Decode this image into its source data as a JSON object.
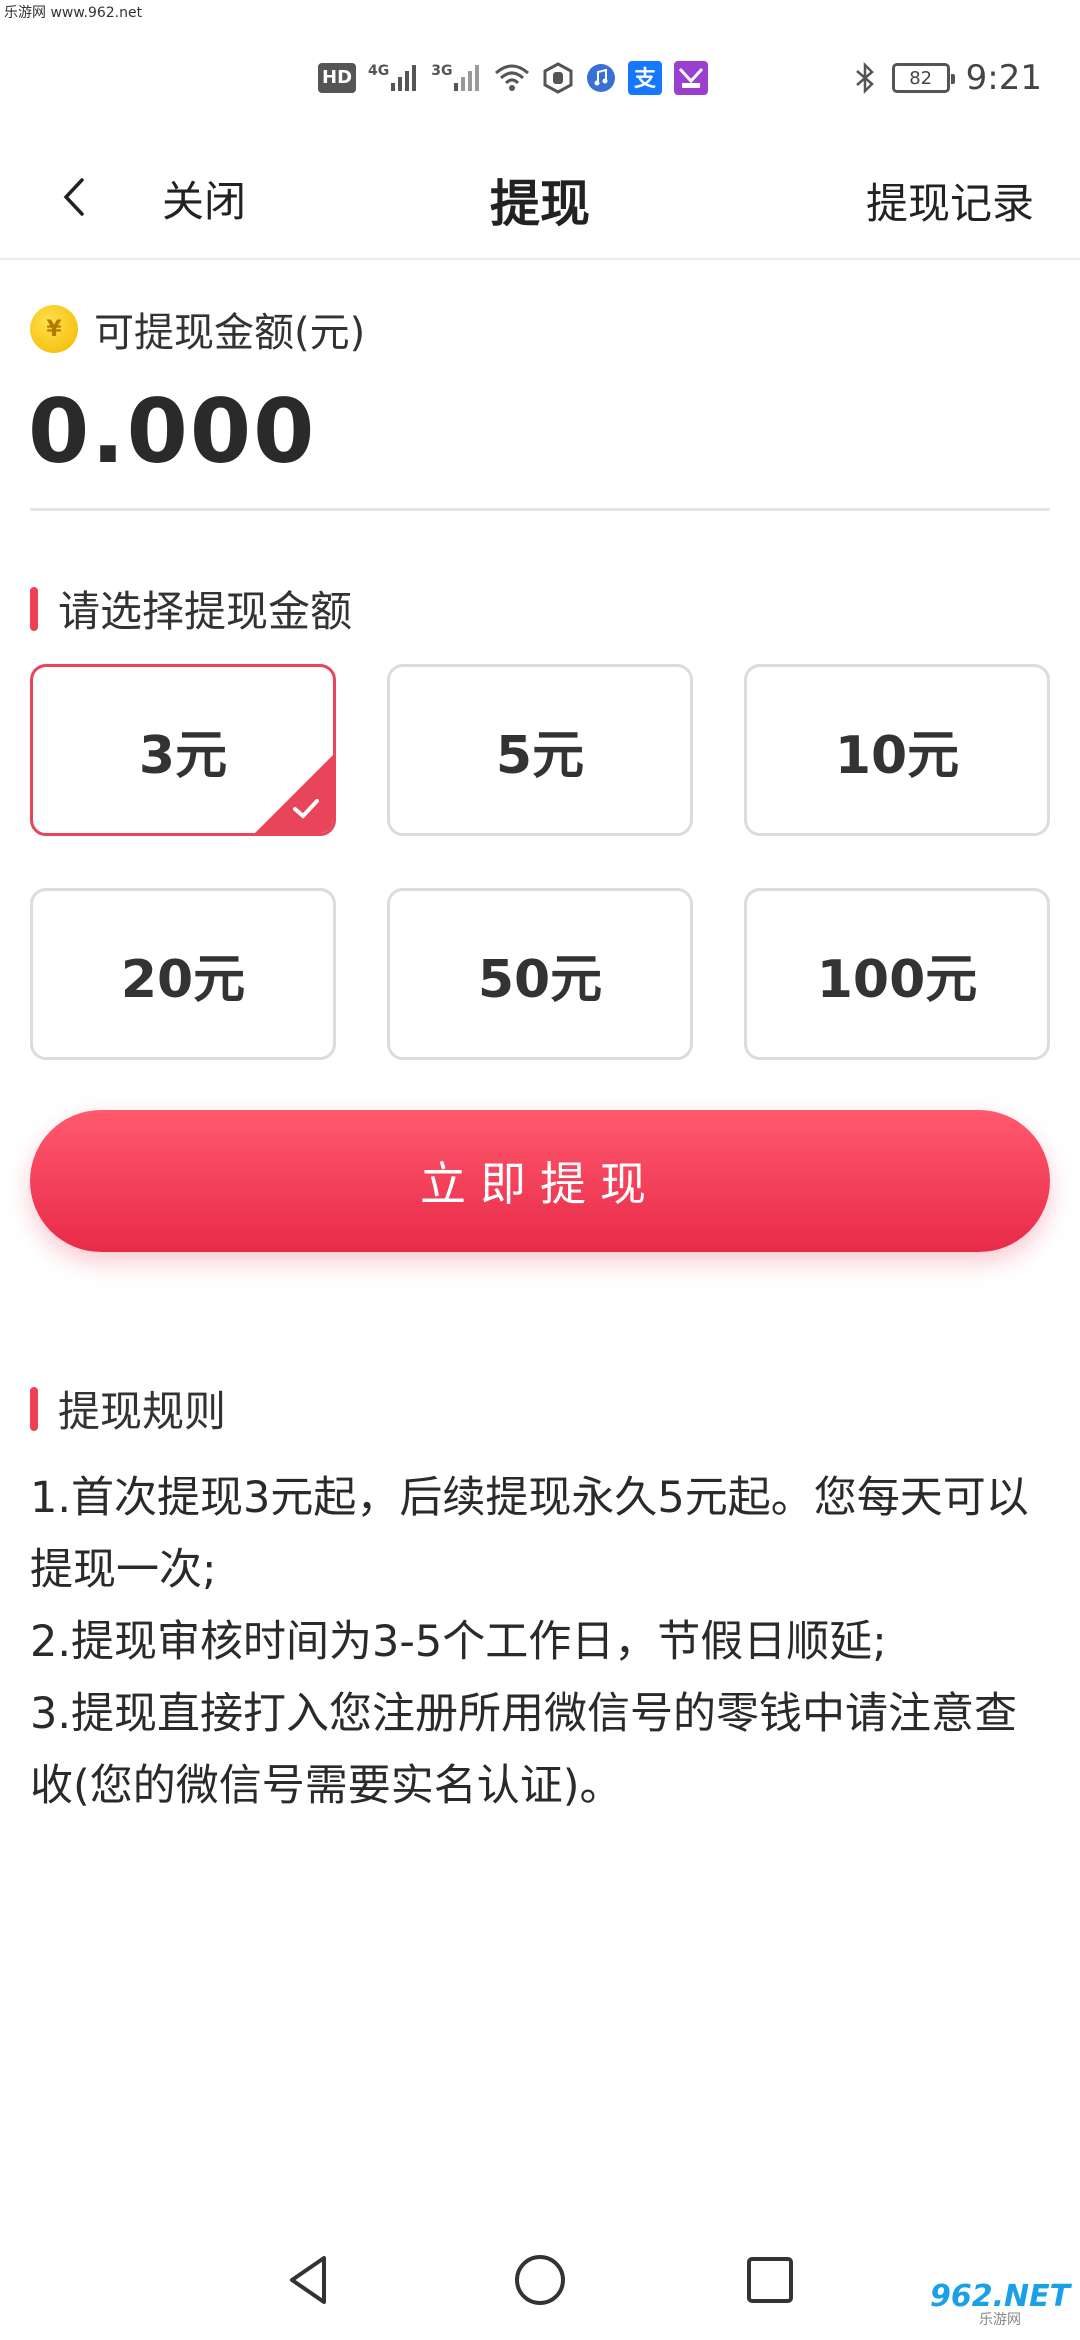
{
  "watermark": {
    "top_left": "乐游网 www.962.net",
    "bottom_right_main": "962.NET",
    "bottom_right_sub": "乐游网"
  },
  "status_bar": {
    "hd_label": "HD",
    "net1": "4G",
    "net2": "3G",
    "battery": "82",
    "time": "9:21",
    "icons": [
      "hd-icon",
      "signal-4g-icon",
      "signal-3g-icon",
      "wifi-icon",
      "hand-icon",
      "music-icon",
      "alipay-icon",
      "app-icon",
      "bluetooth-icon",
      "battery-icon"
    ]
  },
  "nav": {
    "close_label": "关闭",
    "title": "提现",
    "record_label": "提现记录"
  },
  "balance": {
    "label": "可提现金额(元)",
    "coin_symbol": "¥",
    "value": "0.000"
  },
  "select_section": {
    "title": "请选择提现金额"
  },
  "amounts": [
    {
      "label": "3元",
      "selected": true
    },
    {
      "label": "5元",
      "selected": false
    },
    {
      "label": "10元",
      "selected": false
    },
    {
      "label": "20元",
      "selected": false
    },
    {
      "label": "50元",
      "selected": false
    },
    {
      "label": "100元",
      "selected": false
    }
  ],
  "cta": {
    "label": "立即提现"
  },
  "rules_section": {
    "title": "提现规则",
    "lines": [
      "1.首次提现3元起，后续提现永久5元起。您每天可以提现一次;",
      "2.提现审核时间为3-5个工作日，节假日顺延;",
      "3.提现直接打入您注册所用微信号的零钱中请注意查收(您的微信号需要实名认证)。"
    ]
  },
  "colors": {
    "accent": "#e8445a",
    "cta_top": "#ff5a6e",
    "cta_bottom": "#e82a48",
    "coin": "#f3b800"
  }
}
